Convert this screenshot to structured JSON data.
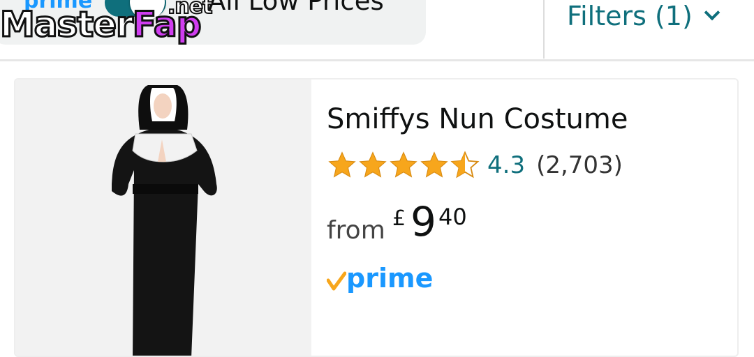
{
  "filter_bar": {
    "prime_badge": "prime",
    "toggle_label": "All Low Prices",
    "filters_label": "Filters (1)"
  },
  "watermark": {
    "text_left": "Master",
    "text_right": "Fap",
    "suffix": ".net"
  },
  "product": {
    "title": "Smiffys Nun Costume",
    "rating": {
      "value": "4.3",
      "count": "(2,703)",
      "stars_full": 4,
      "stars_half": 1,
      "star_color": "#f7a61c"
    },
    "price": {
      "prefix": "from",
      "currency": "£",
      "whole": "9",
      "fraction": "40"
    },
    "prime_badge": "prime",
    "colors": {
      "link": "#0f6f7c",
      "prime_blue": "#1a98ff",
      "prime_check": "#f7a61c"
    }
  }
}
